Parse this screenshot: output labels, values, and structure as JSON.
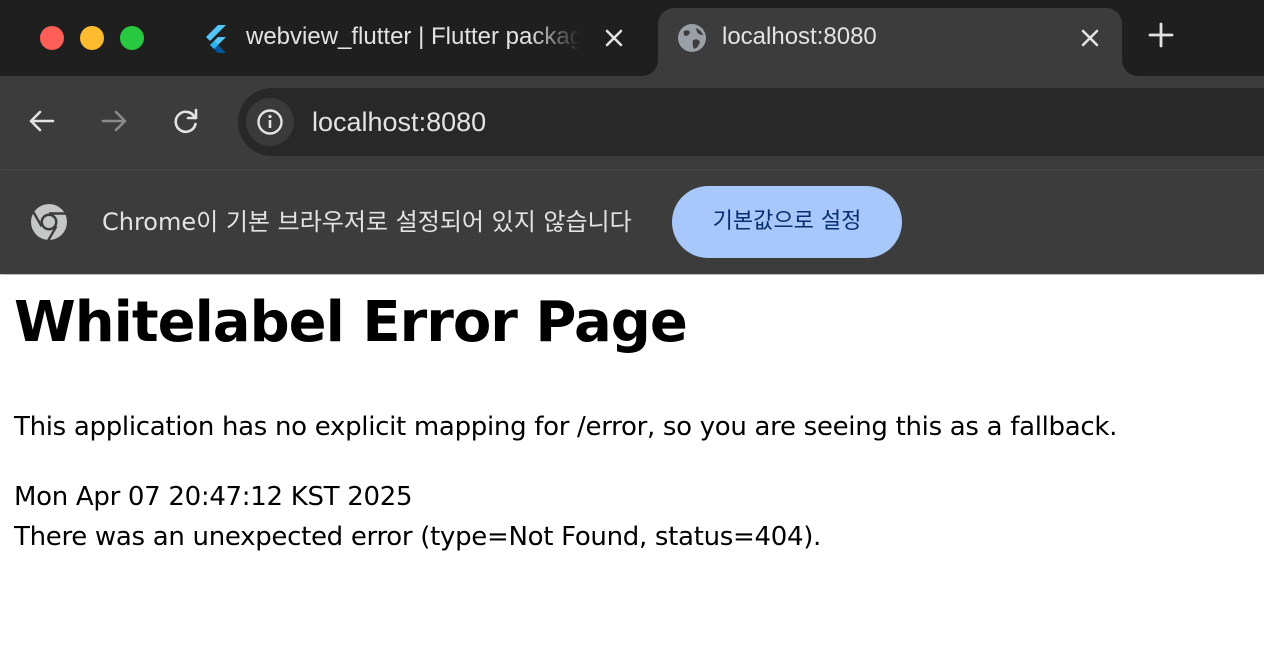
{
  "browser": {
    "tabs": [
      {
        "title": "webview_flutter | Flutter package",
        "icon": "flutter-icon",
        "active": false
      },
      {
        "title": "localhost:8080",
        "icon": "globe-icon",
        "active": true
      }
    ],
    "new_tab_icon": "plus-icon",
    "close_icon": "close-icon"
  },
  "toolbar": {
    "back_icon": "back-arrow-icon",
    "forward_icon": "forward-arrow-icon",
    "reload_icon": "reload-icon",
    "url": "localhost:8080",
    "site_info_icon": "info-icon"
  },
  "infobar": {
    "icon": "chrome-logo-icon",
    "message": "Chrome이 기본 브라우저로 설정되어 있지 않습니다",
    "button_label": "기본값으로 설정"
  },
  "page": {
    "title": "Whitelabel Error Page",
    "description": "This application has no explicit mapping for /error, so you are seeing this as a fallback.",
    "timestamp": "Mon Apr 07 20:47:12 KST 2025",
    "error_message": "There was an unexpected error (type=Not Found, status=404)."
  },
  "colors": {
    "tabstrip_bg": "#1f1f1f",
    "toolbar_bg": "#3c3c3c",
    "omnibox_bg": "#282828",
    "button_bg": "#a8c7fa",
    "button_text": "#062e6f",
    "traffic_red": "#ff5f57",
    "traffic_yellow": "#febc2e",
    "traffic_green": "#28c840"
  }
}
